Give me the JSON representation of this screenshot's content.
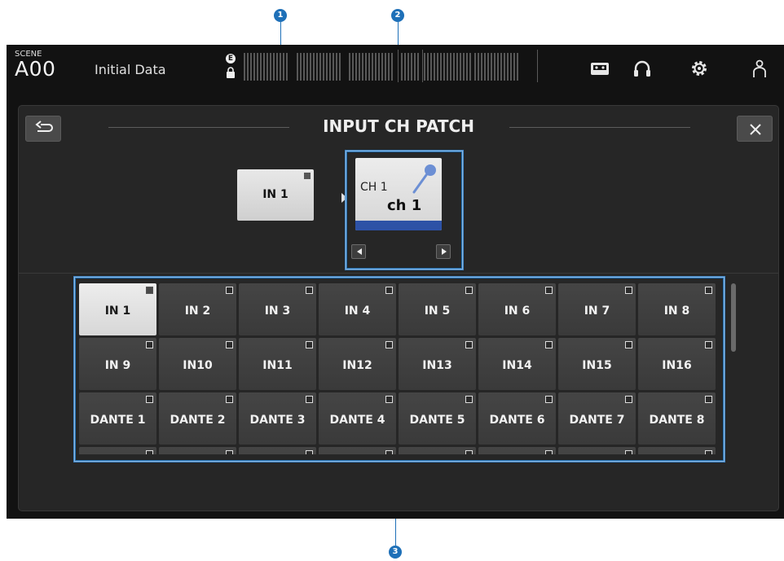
{
  "callouts": [
    "1",
    "2",
    "3"
  ],
  "status": {
    "scene_label": "SCENE",
    "scene_number": "A00",
    "scene_name": "Initial Data",
    "e_badge": "E"
  },
  "top_icons": [
    "recorder-icon",
    "headphones-icon",
    "settings-gear-icon",
    "user-icon"
  ],
  "panel": {
    "title": "INPUT CH PATCH",
    "back_icon": "back-arrow-icon",
    "close_icon": "close-icon"
  },
  "patch": {
    "selected_input": "IN 1",
    "channel_number": "CH 1",
    "channel_name": "ch 1",
    "channel_icon": "microphone-icon",
    "channel_color": "#2d52a6"
  },
  "grid": {
    "selected": "IN 1",
    "rows": [
      [
        "IN 1",
        "IN 2",
        "IN 3",
        "IN 4",
        "IN 5",
        "IN 6",
        "IN 7",
        "IN 8"
      ],
      [
        "IN 9",
        "IN10",
        "IN11",
        "IN12",
        "IN13",
        "IN14",
        "IN15",
        "IN16"
      ],
      [
        "DANTE 1",
        "DANTE 2",
        "DANTE 3",
        "DANTE 4",
        "DANTE 5",
        "DANTE 6",
        "DANTE 7",
        "DANTE 8"
      ]
    ]
  },
  "colors": {
    "accent": "#1e70b8",
    "panel": "#262626"
  }
}
